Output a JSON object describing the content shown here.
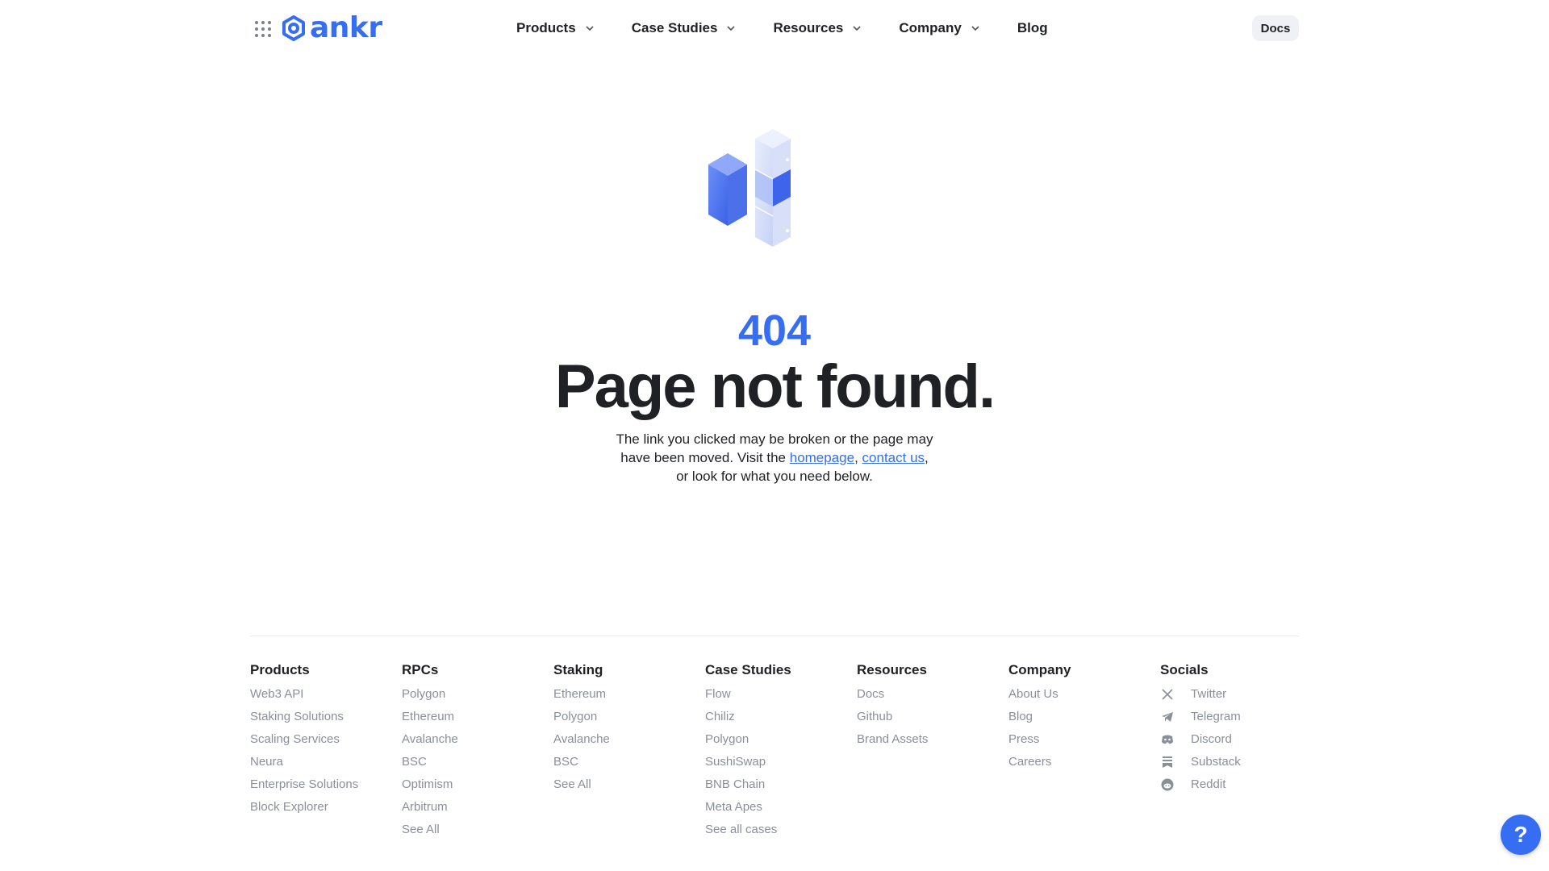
{
  "header": {
    "logo_text": "ankr",
    "nav": [
      {
        "label": "Products",
        "has_dropdown": true
      },
      {
        "label": "Case Studies",
        "has_dropdown": true
      },
      {
        "label": "Resources",
        "has_dropdown": true
      },
      {
        "label": "Company",
        "has_dropdown": true
      },
      {
        "label": "Blog",
        "has_dropdown": false
      }
    ],
    "docs_label": "Docs"
  },
  "hero": {
    "code": "404",
    "title": "Page not found.",
    "desc_line1": "The link you clicked may be broken or the page may",
    "desc_line2_prefix": "have been moved. Visit the ",
    "homepage_link": "homepage",
    "comma": ", ",
    "contact_link": "contact us",
    "desc_line2_suffix": ",",
    "desc_line3": "or look for what you need below."
  },
  "footer": {
    "columns": [
      {
        "title": "Products",
        "links": [
          "Web3 API",
          "Staking Solutions",
          "Scaling Services",
          "Neura",
          "Enterprise Solutions",
          "Block Explorer"
        ]
      },
      {
        "title": "RPCs",
        "links": [
          "Polygon",
          "Ethereum",
          "Avalanche",
          "BSC",
          "Optimism",
          "Arbitrum",
          "See All"
        ]
      },
      {
        "title": "Staking",
        "links": [
          "Ethereum",
          "Polygon",
          "Avalanche",
          "BSC",
          "See All"
        ]
      },
      {
        "title": "Case Studies",
        "links": [
          "Flow",
          "Chiliz",
          "Polygon",
          "SushiSwap",
          "BNB Chain",
          "Meta Apes",
          "See all cases"
        ]
      },
      {
        "title": "Resources",
        "links": [
          "Docs",
          "Github",
          "Brand Assets"
        ]
      },
      {
        "title": "Company",
        "links": [
          "About Us",
          "Blog",
          "Press",
          "Careers"
        ]
      }
    ],
    "socials": {
      "title": "Socials",
      "items": [
        {
          "label": "Twitter",
          "icon": "x-icon"
        },
        {
          "label": "Telegram",
          "icon": "telegram-icon"
        },
        {
          "label": "Discord",
          "icon": "discord-icon"
        },
        {
          "label": "Substack",
          "icon": "substack-icon"
        },
        {
          "label": "Reddit",
          "icon": "reddit-icon"
        }
      ]
    }
  },
  "help_button": {
    "label": "?"
  },
  "colors": {
    "brand": "#356df3",
    "text": "#1f2125",
    "muted": "#8a8f99"
  }
}
